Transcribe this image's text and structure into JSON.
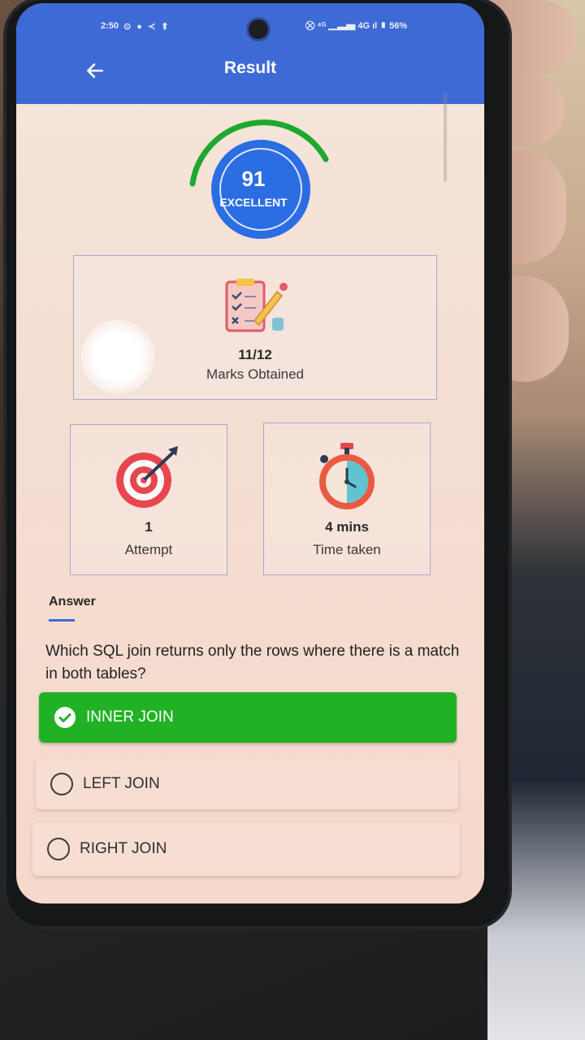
{
  "status_bar": {
    "time": "2:50",
    "icons_left": "⊙ ● ≺ ⬆",
    "icons_right": "⛒ ⁴ᴳ ▁▃▅ 4G ıl ▮ 56%"
  },
  "app_bar": {
    "title": "Result",
    "back_icon": "arrow-left-icon"
  },
  "score": {
    "value": "91",
    "label": "EXCELLENT",
    "colors": {
      "arc": "#1fa82e",
      "circle": "#2b6de3"
    }
  },
  "marks_card": {
    "icon": "clipboard-checklist-icon",
    "value": "11/12",
    "label": "Marks Obtained"
  },
  "attempt_card": {
    "icon": "target-dart-icon",
    "value": "1",
    "label": "Attempt"
  },
  "time_card": {
    "icon": "stopwatch-icon",
    "value": "4 mins",
    "label": "Time taken"
  },
  "answer": {
    "heading": "Answer",
    "question": "Which SQL join returns only the rows where there is a match in both tables?",
    "options": [
      {
        "label": "INNER JOIN",
        "state": "correct"
      },
      {
        "label": "LEFT JOIN",
        "state": "unselected"
      },
      {
        "label": "RIGHT JOIN",
        "state": "unselected"
      }
    ]
  },
  "colors": {
    "app_bar": "#3e6ad6",
    "correct": "#20b224",
    "background": "#f5e3d8"
  }
}
